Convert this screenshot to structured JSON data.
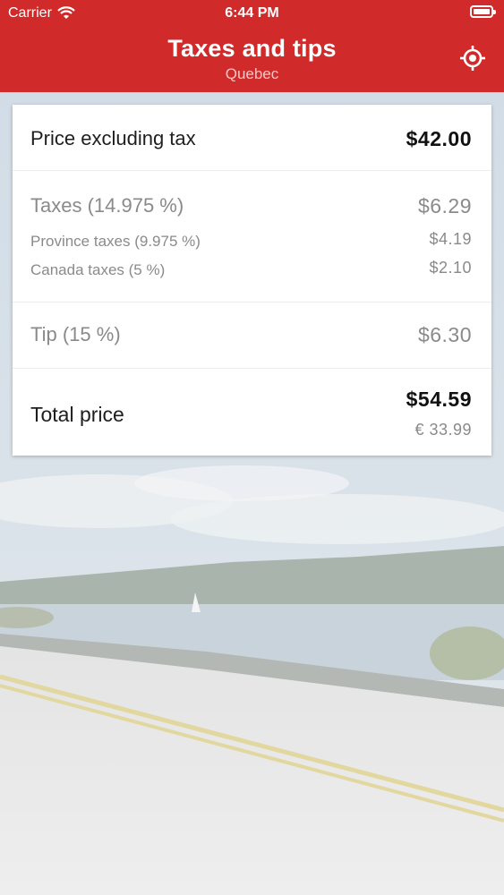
{
  "status_bar": {
    "carrier": "Carrier",
    "time": "6:44 PM"
  },
  "header": {
    "title": "Taxes and tips",
    "subtitle": "Quebec",
    "location_icon": "location-target-icon"
  },
  "card": {
    "price": {
      "label": "Price excluding tax",
      "value": "$42.00"
    },
    "taxes": {
      "label": "Taxes (14.975 %)",
      "value": "$6.29",
      "province_label": "Province taxes (9.975 %)",
      "province_value": "$4.19",
      "canada_label": "Canada taxes (5 %)",
      "canada_value": "$2.10"
    },
    "tip": {
      "label": "Tip (15 %)",
      "value": "$6.30"
    },
    "total": {
      "label": "Total price",
      "value": "$54.59",
      "converted_value": "€ 33.99"
    }
  },
  "colors": {
    "header": "#d02a2a",
    "card": "#ffffff",
    "muted_text": "#8a8a8a"
  }
}
